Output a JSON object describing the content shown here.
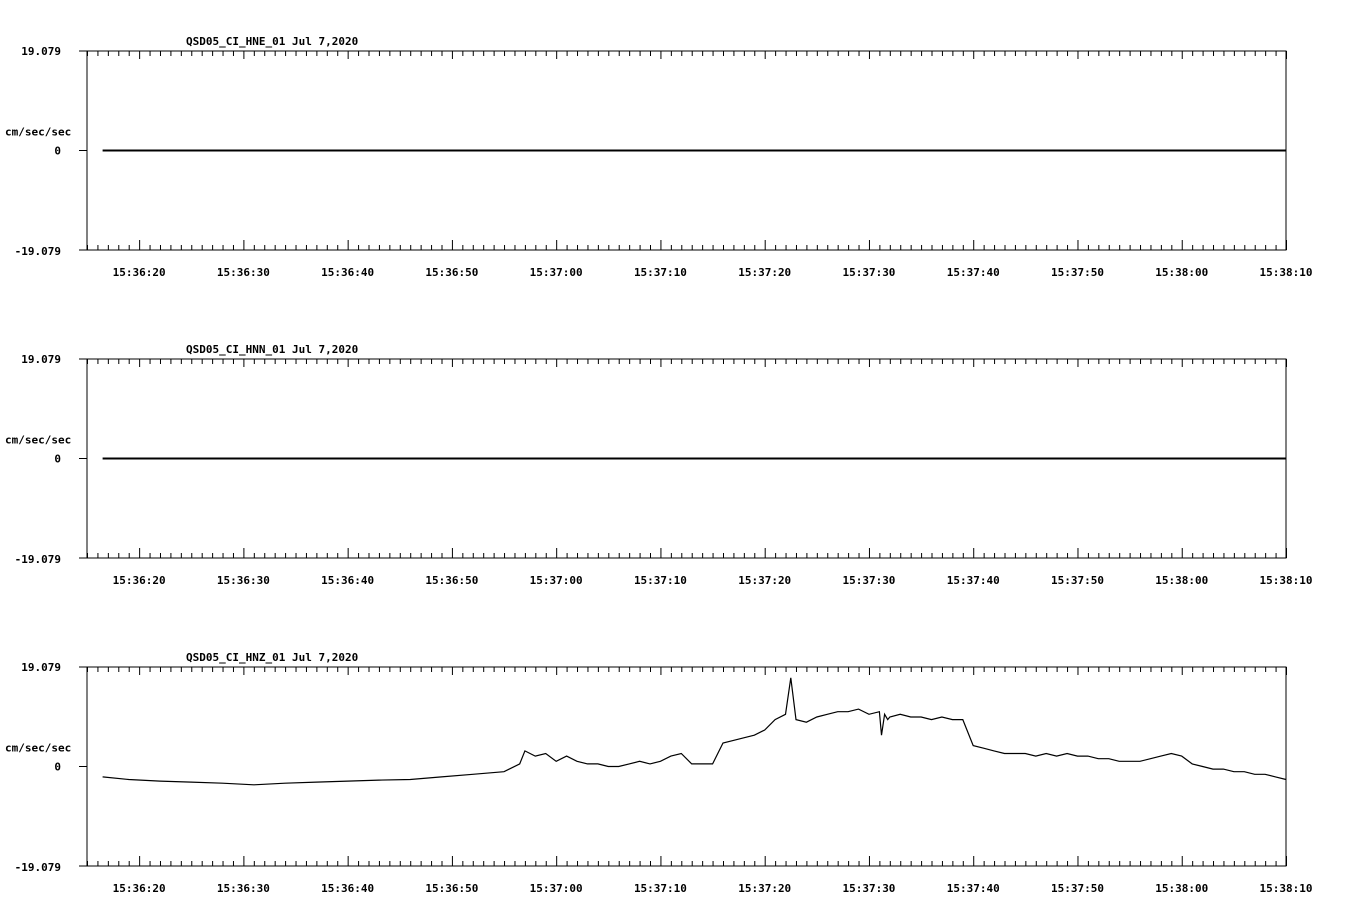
{
  "page": {
    "background": "#ffffff",
    "trace_color": "#000000"
  },
  "chart_data": [
    {
      "type": "line",
      "title": "QSD05_CI_HNE_01  Jul 7,2020",
      "ylabel": "cm/sec/sec",
      "ylim": [
        -19.079,
        19.079
      ],
      "y_tick_labels": [
        "19.079",
        "0",
        "-19.079"
      ],
      "x_tick_labels": [
        "15:36:20",
        "15:36:30",
        "15:36:40",
        "15:36:50",
        "15:37:00",
        "15:37:10",
        "15:37:20",
        "15:37:30",
        "15:37:40",
        "15:37:50",
        "15:38:00",
        "15:38:10"
      ],
      "xlim_seconds": [
        15,
        130
      ],
      "series": [
        {
          "x": [
            16.5,
            130
          ],
          "y": [
            0.0,
            0.0
          ]
        }
      ]
    },
    {
      "type": "line",
      "title": "QSD05_CI_HNN_01  Jul 7,2020",
      "ylabel": "cm/sec/sec",
      "ylim": [
        -19.079,
        19.079
      ],
      "y_tick_labels": [
        "19.079",
        "0",
        "-19.079"
      ],
      "x_tick_labels": [
        "15:36:20",
        "15:36:30",
        "15:36:40",
        "15:36:50",
        "15:37:00",
        "15:37:10",
        "15:37:20",
        "15:37:30",
        "15:37:40",
        "15:37:50",
        "15:38:00",
        "15:38:10"
      ],
      "xlim_seconds": [
        15,
        130
      ],
      "series": [
        {
          "x": [
            16.5,
            130
          ],
          "y": [
            0.0,
            0.0
          ]
        }
      ]
    },
    {
      "type": "line",
      "title": "QSD05_CI_HNZ_01  Jul 7,2020",
      "ylabel": "cm/sec/sec",
      "ylim": [
        -19.079,
        19.079
      ],
      "y_tick_labels": [
        "19.079",
        "0",
        "-19.079"
      ],
      "x_tick_labels": [
        "15:36:20",
        "15:36:30",
        "15:36:40",
        "15:36:50",
        "15:37:00",
        "15:37:10",
        "15:37:20",
        "15:37:30",
        "15:37:40",
        "15:37:50",
        "15:38:00",
        "15:38:10"
      ],
      "xlim_seconds": [
        15,
        130
      ],
      "series": [
        {
          "x": [
            16.5,
            19,
            22,
            25,
            28,
            31,
            34,
            37,
            40,
            43,
            46,
            49,
            52,
            55,
            56.5,
            57,
            58,
            59,
            60,
            61,
            62,
            63,
            64,
            65,
            66,
            67,
            68,
            69,
            70,
            71,
            72,
            73,
            74,
            75,
            76,
            77,
            78,
            79,
            80,
            81,
            82,
            82.5,
            83,
            84,
            85,
            86,
            87,
            88,
            89,
            90,
            91,
            91.2,
            91.5,
            91.8,
            92,
            93,
            94,
            95,
            96,
            97,
            98,
            99,
            100,
            101,
            102,
            103,
            104,
            105,
            106,
            107,
            108,
            109,
            110,
            111,
            112,
            113,
            114,
            115,
            116,
            117,
            118,
            119,
            120,
            121,
            122,
            123,
            124,
            125,
            126,
            127,
            128,
            129,
            130
          ],
          "y": [
            -2.0,
            -2.5,
            -2.8,
            -3.0,
            -3.2,
            -3.5,
            -3.2,
            -3.0,
            -2.8,
            -2.6,
            -2.5,
            -2.0,
            -1.5,
            -1.0,
            0.5,
            3.0,
            2.0,
            2.5,
            1.0,
            2.0,
            1.0,
            0.5,
            0.5,
            0.0,
            0.0,
            0.5,
            1.0,
            0.5,
            1.0,
            2.0,
            2.5,
            0.5,
            0.5,
            0.5,
            4.5,
            5.0,
            5.5,
            6.0,
            7.0,
            9.0,
            10.0,
            17.0,
            9.0,
            8.5,
            9.5,
            10.0,
            10.5,
            10.5,
            11.0,
            10.0,
            10.5,
            6.0,
            10.0,
            9.0,
            9.5,
            10.0,
            9.5,
            9.5,
            9.0,
            9.5,
            9.0,
            9.0,
            4.0,
            3.5,
            3.0,
            2.5,
            2.5,
            2.5,
            2.0,
            2.5,
            2.0,
            2.5,
            2.0,
            2.0,
            1.5,
            1.5,
            1.0,
            1.0,
            1.0,
            1.5,
            2.0,
            2.5,
            2.0,
            0.5,
            0.0,
            -0.5,
            -0.5,
            -1.0,
            -1.0,
            -1.5,
            -1.5,
            -2.0,
            -2.5
          ]
        }
      ]
    }
  ]
}
